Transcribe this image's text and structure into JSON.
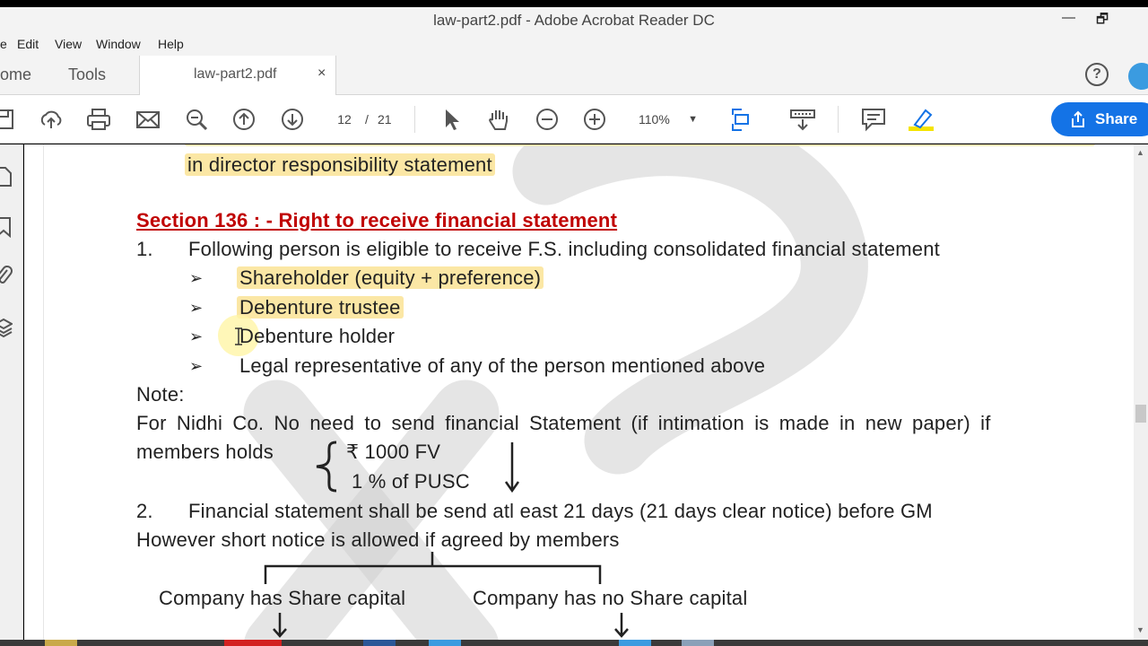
{
  "window": {
    "title": "law-part2.pdf - Adobe Acrobat Reader DC",
    "minimize": "—",
    "restore": "🗗"
  },
  "menu": {
    "items": [
      "e",
      "Edit",
      "View",
      "Window",
      "Help"
    ]
  },
  "tabs": {
    "home": "ome",
    "tools": "Tools",
    "doc": "law-part2.pdf",
    "close": "×",
    "help": "?"
  },
  "toolbar": {
    "page_current": "12",
    "page_sep": "/",
    "page_total": "21",
    "zoom": "110%",
    "zoom_caret": "▼",
    "share": "Share"
  },
  "doc": {
    "prev_line_fragment": "in director responsibility statement",
    "section_heading": "Section 136 : - Right to receive financial statement",
    "item1_num": "1.",
    "item1_text": "Following person is eligible to receive F.S. including consolidated financial statement",
    "bullet_char": "➢",
    "bullets": [
      "Shareholder (equity + preference)",
      "Debenture trustee",
      "Debenture holder",
      "Legal representative of any of the person mentioned above"
    ],
    "note_label": "Note:",
    "note_line1": "For Nidhi Co. No need to send financial Statement (if intimation is made in new paper) if",
    "note_line2": "members holds",
    "brace_opt1": "₹ 1000 FV",
    "brace_opt2": "1 % of PUSC",
    "item2_num": "2.",
    "item2_text": "Financial statement shall be send atl east 21 days (21 days clear notice) before GM",
    "item2_line2": "However short notice is allowed if agreed by members",
    "branch_left": "Company has Share capital",
    "branch_right": "Company has no Share capital"
  },
  "colors": {
    "highlight": "#fbe7a5",
    "heading_red": "#c00000",
    "share_blue": "#1473e6"
  }
}
